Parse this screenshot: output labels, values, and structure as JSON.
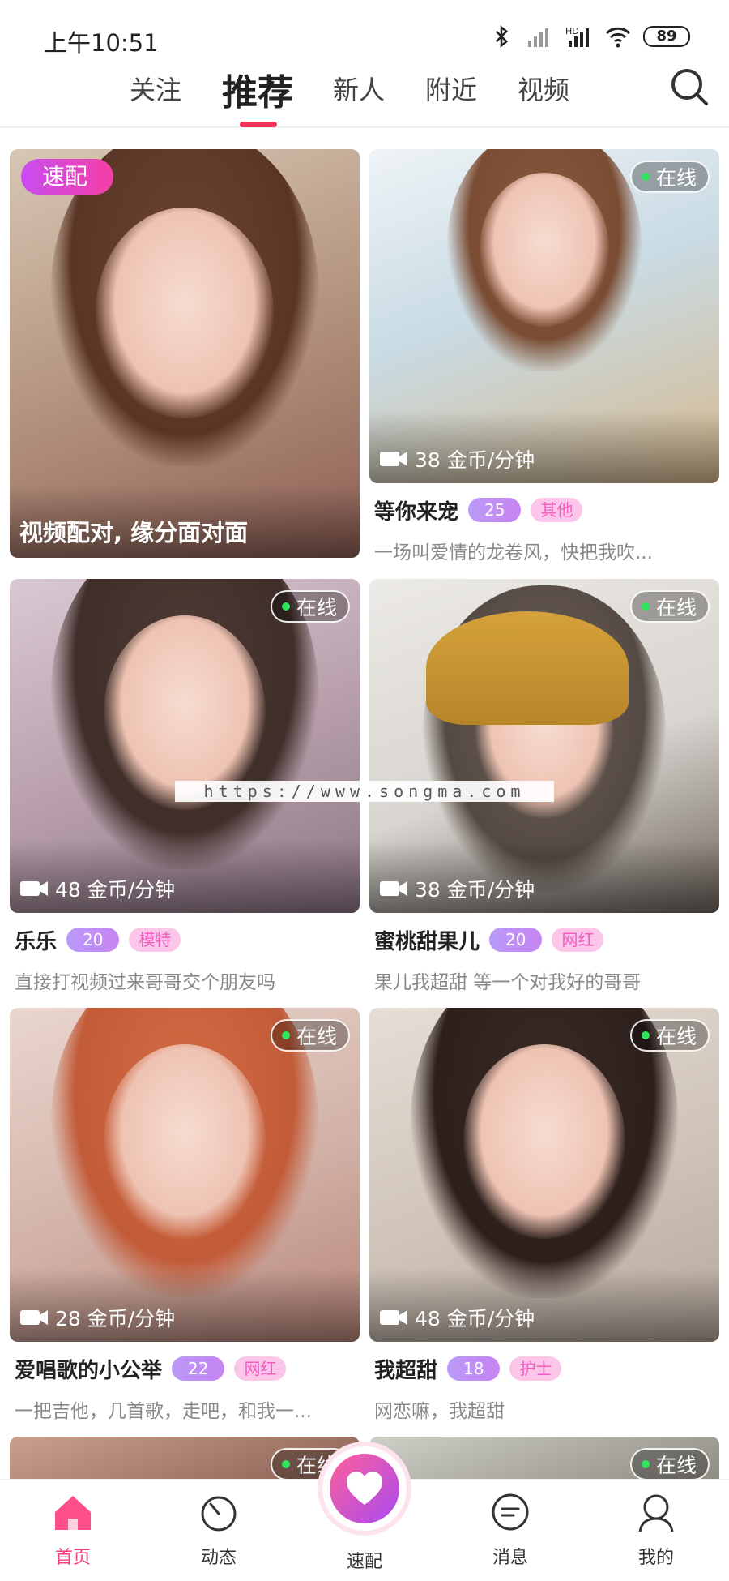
{
  "status_bar": {
    "time": "上午10:51",
    "battery": "89"
  },
  "tabs": [
    {
      "label": "关注"
    },
    {
      "label": "推荐"
    },
    {
      "label": "新人"
    },
    {
      "label": "附近"
    },
    {
      "label": "视频"
    }
  ],
  "active_tab": "推荐",
  "quick_match_card": {
    "badge": "速配",
    "caption": "视频配对, 缘分面对面"
  },
  "online_label": "在线",
  "cards": [
    {
      "name": "等你来宠",
      "age": "25",
      "tag": "其他",
      "price": "38 金币/分钟",
      "bio": "一场叫爱情的龙卷风，快把我吹..."
    },
    {
      "name": "乐乐",
      "age": "20",
      "tag": "模特",
      "price": "48 金币/分钟",
      "bio": "直接打视频过来哥哥交个朋友吗"
    },
    {
      "name": "蜜桃甜果儿",
      "age": "20",
      "tag": "网红",
      "price": "38 金币/分钟",
      "bio": "果儿我超甜 等一个对我好的哥哥"
    },
    {
      "name": "爱唱歌的小公举",
      "age": "22",
      "tag": "网红",
      "price": "28 金币/分钟",
      "bio": "一把吉他，几首歌，走吧，和我一..."
    },
    {
      "name": "我超甜",
      "age": "18",
      "tag": "护士",
      "price": "48 金币/分钟",
      "bio": "网恋嘛，我超甜"
    }
  ],
  "watermark": "https://www.songma.com",
  "bottom_nav": [
    {
      "label": "首页",
      "icon": "home-icon"
    },
    {
      "label": "动态",
      "icon": "moments-icon"
    },
    {
      "label": "速配",
      "icon": "heart-icon"
    },
    {
      "label": "消息",
      "icon": "message-icon"
    },
    {
      "label": "我的",
      "icon": "profile-icon"
    }
  ],
  "colors": {
    "accent": "#f3325a",
    "online_dot": "#2ee65c",
    "age_badge": "#c784f1",
    "tag_bg": "#fbc6ea",
    "nav_active": "#f43f7e"
  }
}
